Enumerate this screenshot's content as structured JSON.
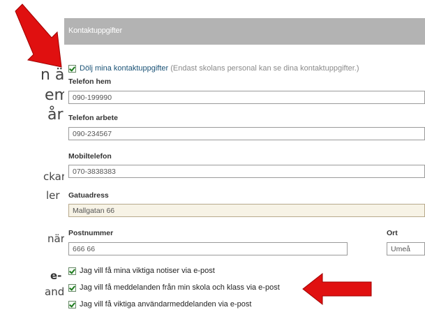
{
  "slide_fragments": [
    "n är",
    "em",
    "år",
    "ckar",
    "ler",
    "när",
    "e-",
    "ande"
  ],
  "header": {
    "title": "Kontaktuppgifter"
  },
  "hide_contact": {
    "label": "Dölj mina kontaktuppgifter",
    "hint": "(Endast skolans personal kan se dina kontaktuppgifter.)",
    "checked": true
  },
  "fields": {
    "phone_home": {
      "label": "Telefon hem",
      "value": "090-199990"
    },
    "phone_work": {
      "label": "Telefon arbete",
      "value": "090-234567"
    },
    "mobile": {
      "label": "Mobiltelefon",
      "value": "070-3838383"
    },
    "street": {
      "label": "Gatuadress",
      "value": "Mallgatan 66"
    },
    "postcode": {
      "label": "Postnummer",
      "value": "666 66"
    },
    "city": {
      "label": "Ort",
      "value": "Umeå"
    }
  },
  "email_options": [
    {
      "label": "Jag vill få mina viktiga notiser via e-post",
      "checked": true
    },
    {
      "label": "Jag vill få meddelanden från min skola och klass via e-post",
      "checked": true
    },
    {
      "label": "Jag vill få viktiga användarmeddelanden via e-post",
      "checked": true
    }
  ],
  "colors": {
    "header_bg": "#b3b3b3",
    "arrow": "#e01010",
    "checkmark": "#1d7a1d"
  }
}
